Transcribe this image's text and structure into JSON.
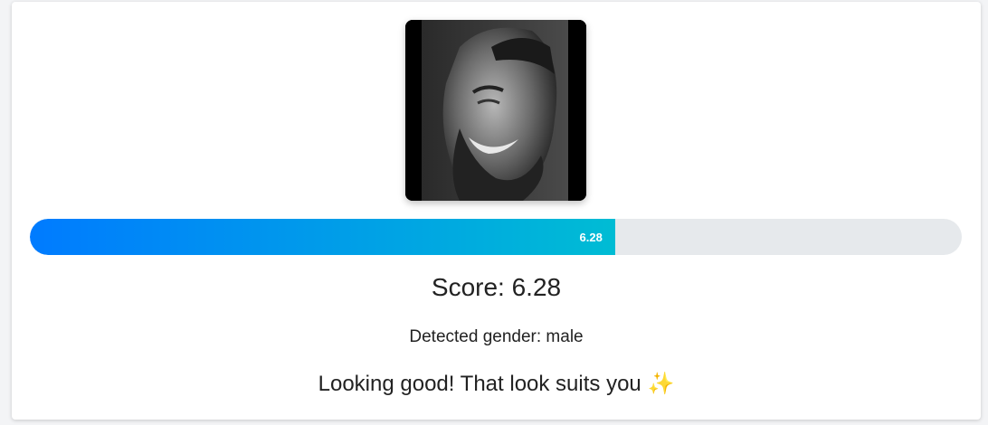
{
  "photo": {
    "description_icon": "face-photo"
  },
  "progress": {
    "value": 6.28,
    "max": 10,
    "label": "6.28",
    "color_start": "#007bff",
    "color_end": "#00bcd4",
    "track_color": "#e6e9ec"
  },
  "result": {
    "score_text": "Score: 6.28",
    "gender_text": "Detected gender: male",
    "message_text": "Looking good! That look suits you",
    "message_emoji": "✨"
  }
}
